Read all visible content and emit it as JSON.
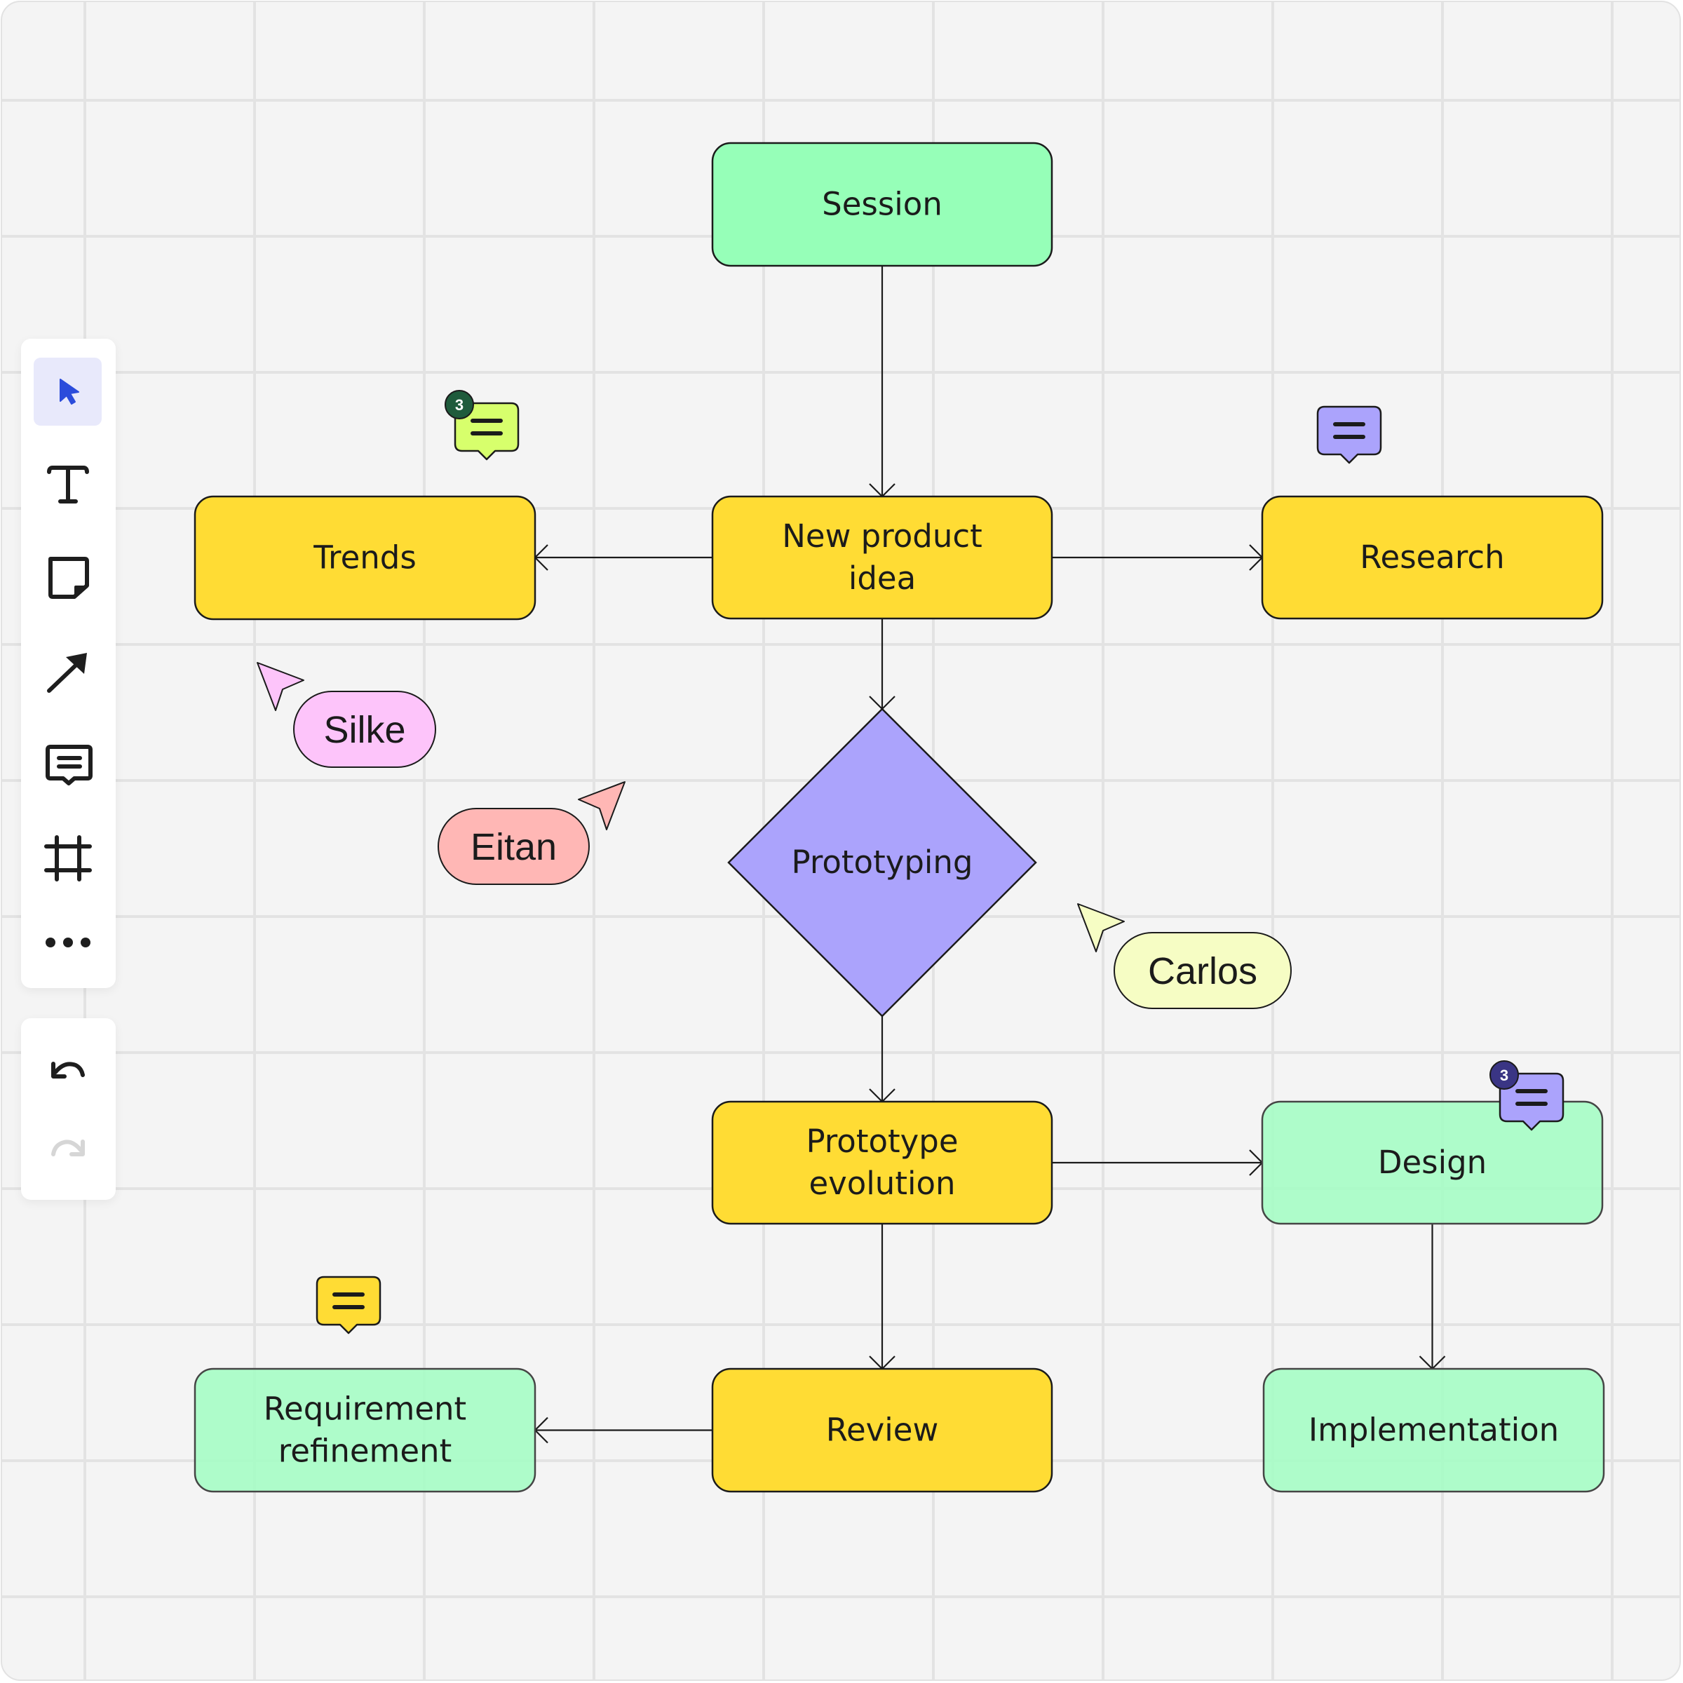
{
  "colors": {
    "board_bg": "#f4f4f4",
    "grid": "#e3e3e3",
    "yellow": "#ffdc34",
    "green_bright": "#96ffb8",
    "green_soft": "#a7fcc6",
    "purple": "#aba3fc",
    "lime": "#d7ff6c",
    "pink": "#fdc4fa",
    "salmon": "#ffb7b5",
    "cream": "#f6fdc4",
    "badge_dark_green": "#1f5b3c",
    "badge_dark_purple": "#3a3584",
    "accent_blue": "#2b4cdb"
  },
  "toolbar": {
    "tools": [
      {
        "id": "select",
        "icon": "cursor-icon",
        "active": true
      },
      {
        "id": "text",
        "icon": "text-icon",
        "active": false
      },
      {
        "id": "sticky-note",
        "icon": "sticky-note-icon",
        "active": false
      },
      {
        "id": "arrow",
        "icon": "arrow-icon",
        "active": false
      },
      {
        "id": "comment",
        "icon": "comment-icon",
        "active": false
      },
      {
        "id": "frame",
        "icon": "frame-icon",
        "active": false
      },
      {
        "id": "more",
        "icon": "more-icon",
        "active": false
      }
    ],
    "history": [
      {
        "id": "undo",
        "icon": "undo-icon",
        "enabled": true
      },
      {
        "id": "redo",
        "icon": "redo-icon",
        "enabled": false
      }
    ]
  },
  "nodes": {
    "session": {
      "lines": [
        "Session"
      ],
      "shape": "rounded-rect",
      "color": "green_bright"
    },
    "new_product_idea": {
      "lines": [
        "New product",
        "idea"
      ],
      "shape": "rounded-rect",
      "color": "yellow"
    },
    "trends": {
      "lines": [
        "Trends"
      ],
      "shape": "rounded-rect",
      "color": "yellow"
    },
    "research": {
      "lines": [
        "Research"
      ],
      "shape": "rounded-rect",
      "color": "yellow"
    },
    "prototyping": {
      "lines": [
        "Prototyping"
      ],
      "shape": "diamond",
      "color": "purple"
    },
    "prototype_evolution": {
      "lines": [
        "Prototype",
        "evolution"
      ],
      "shape": "rounded-rect",
      "color": "yellow"
    },
    "design": {
      "lines": [
        "Design"
      ],
      "shape": "rounded-rect",
      "color": "green_soft"
    },
    "review": {
      "lines": [
        "Review"
      ],
      "shape": "rounded-rect",
      "color": "yellow"
    },
    "requirement_refinement": {
      "lines": [
        "Requirement",
        "refinement"
      ],
      "shape": "rounded-rect",
      "color": "green_soft"
    },
    "implementation": {
      "lines": [
        "Implementation"
      ],
      "shape": "rounded-rect",
      "color": "green_soft"
    }
  },
  "edges": [
    {
      "from": "session",
      "to": "new_product_idea"
    },
    {
      "from": "new_product_idea",
      "to": "trends"
    },
    {
      "from": "new_product_idea",
      "to": "research"
    },
    {
      "from": "new_product_idea",
      "to": "prototyping"
    },
    {
      "from": "prototyping",
      "to": "prototype_evolution"
    },
    {
      "from": "prototype_evolution",
      "to": "design"
    },
    {
      "from": "prototype_evolution",
      "to": "review"
    },
    {
      "from": "design",
      "to": "implementation"
    },
    {
      "from": "review",
      "to": "requirement_refinement"
    }
  ],
  "comments": [
    {
      "near": "trends",
      "color": "lime",
      "count": "3",
      "badge_color": "badge_dark_green"
    },
    {
      "near": "research",
      "color": "purple",
      "count": null
    },
    {
      "near": "design",
      "color": "purple",
      "count": "3",
      "badge_color": "badge_dark_purple"
    },
    {
      "near": "requirement_refinement",
      "color": "yellow",
      "count": null
    }
  ],
  "cursors": [
    {
      "name": "Silke",
      "color": "pink"
    },
    {
      "name": "Eitan",
      "color": "salmon"
    },
    {
      "name": "Carlos",
      "color": "cream"
    }
  ]
}
